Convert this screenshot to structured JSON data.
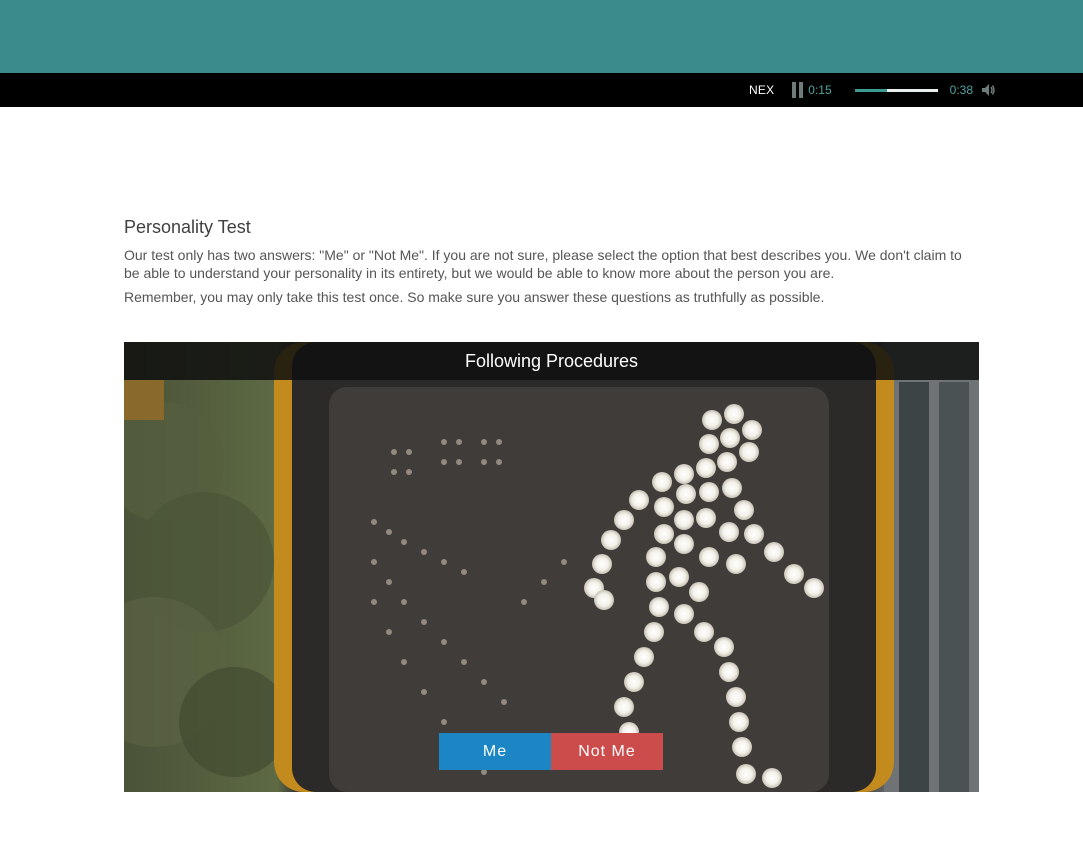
{
  "player": {
    "station": "NEX",
    "elapsed": "0:15",
    "duration": "0:38",
    "progress_fraction": 0.39,
    "accent_color": "#3c9a93",
    "pause_icon": "pause-icon",
    "volume_icon": "volume-icon"
  },
  "header_color": "#3a8b8a",
  "test": {
    "title": "Personality Test",
    "paragraph1": "Our test only has two answers: \"Me\" or \"Not Me\". If you are not sure, please select the option that best describes you. We don't claim to be able to understand your personality in its entirety, but we would be able to know more about the person you are.",
    "paragraph2": "Remember, you may only take this test once. So make sure you answer these questions as truthfully as possible."
  },
  "question": {
    "title": "Following Procedures",
    "buttons": {
      "me": "Me",
      "not_me": "Not Me",
      "me_color": "#1b86c3",
      "not_me_color": "#cc4c4c"
    }
  }
}
